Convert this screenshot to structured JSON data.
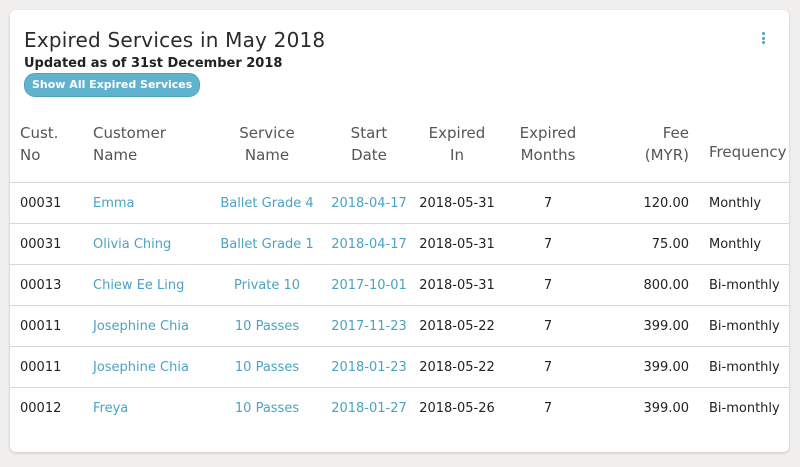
{
  "header": {
    "title": "Expired Services in May 2018",
    "subtitle": "Updated as of 31st December 2018",
    "button_label": "Show All Expired Services"
  },
  "colors": {
    "accent": "#5fb3cf",
    "link": "#4aa3c4"
  },
  "icons": {
    "menu": "more-vertical-icon"
  },
  "table": {
    "columns": [
      "Cust.\nNo",
      "Customer\nName",
      "Service\nName",
      "Start\nDate",
      "Expired\nIn",
      "Expired\nMonths",
      "Fee\n(MYR)",
      "Frequency"
    ],
    "rows": [
      [
        "00031",
        "Emma",
        "Ballet Grade 4",
        "2018-04-17",
        "2018-05-31",
        "7",
        "120.00",
        "Monthly"
      ],
      [
        "00031",
        "Olivia Ching",
        "Ballet Grade 1",
        "2018-04-17",
        "2018-05-31",
        "7",
        "75.00",
        "Monthly"
      ],
      [
        "00013",
        "Chiew Ee Ling",
        "Private 10",
        "2017-10-01",
        "2018-05-31",
        "7",
        "800.00",
        "Bi-monthly"
      ],
      [
        "00011",
        "Josephine Chia",
        "10 Passes",
        "2017-11-23",
        "2018-05-22",
        "7",
        "399.00",
        "Bi-monthly"
      ],
      [
        "00011",
        "Josephine Chia",
        "10 Passes",
        "2018-01-23",
        "2018-05-22",
        "7",
        "399.00",
        "Bi-monthly"
      ],
      [
        "00012",
        "Freya",
        "10 Passes",
        "2018-01-27",
        "2018-05-26",
        "7",
        "399.00",
        "Bi-monthly"
      ]
    ]
  }
}
